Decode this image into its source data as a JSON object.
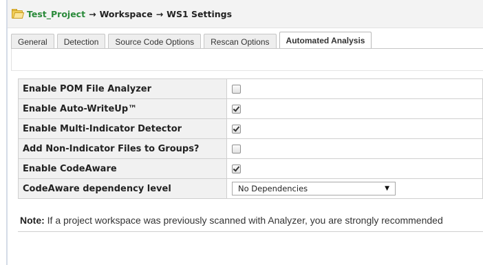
{
  "breadcrumb": {
    "icon": "folder-icon",
    "project": "Test_Project",
    "separator": "→",
    "workspace": "Workspace",
    "current": "WS1 Settings"
  },
  "tabs": [
    {
      "label": "General",
      "active": false
    },
    {
      "label": "Detection",
      "active": false
    },
    {
      "label": "Source Code Options",
      "active": false
    },
    {
      "label": "Rescan Options",
      "active": false
    },
    {
      "label": "Automated Analysis",
      "active": true
    }
  ],
  "settings": [
    {
      "label": "Enable POM File Analyzer",
      "checked": false
    },
    {
      "label": "Enable Auto-WriteUp™",
      "checked": true
    },
    {
      "label": "Enable Multi-Indicator Detector",
      "checked": true
    },
    {
      "label": "Add Non-Indicator Files to Groups?",
      "checked": false
    },
    {
      "label": "Enable CodeAware",
      "checked": true
    }
  ],
  "dependency": {
    "label": "CodeAware dependency level",
    "selected": "No Dependencies",
    "arrow": "▼"
  },
  "note": {
    "prefix": "Note:",
    "text": " If a project workspace was previously scanned with Analyzer, you are strongly recommended"
  }
}
